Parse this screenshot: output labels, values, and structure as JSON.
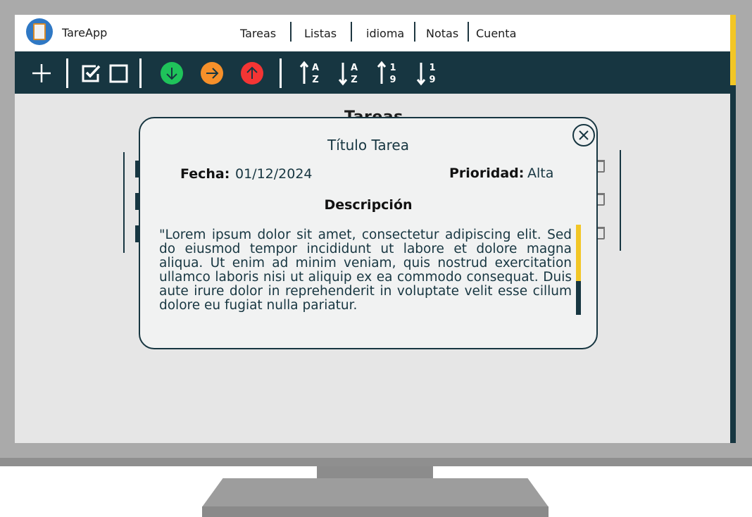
{
  "app": {
    "name": "TareApp",
    "logo_icon": "clipboard-icon"
  },
  "nav": {
    "items": [
      "Tareas",
      "Listas",
      "idioma",
      "Notas",
      "Cuenta"
    ]
  },
  "toolbar": {
    "icons": [
      "plus-icon",
      "check-all-icon",
      "uncheck-all-icon",
      "priority-low-icon",
      "priority-medium-icon",
      "priority-high-icon",
      "sort-alpha-asc-icon",
      "sort-alpha-desc-icon",
      "sort-numeric-asc-icon",
      "sort-numeric-desc-icon"
    ],
    "sort_letters": {
      "a": "A",
      "z": "Z",
      "one": "1",
      "nine": "9"
    }
  },
  "background": {
    "list_title": "Tareas"
  },
  "modal": {
    "title": "Título Tarea",
    "date_label": "Fecha:",
    "date_value": "01/12/2024",
    "priority_label": "Prioridad:",
    "priority_value": "Alta",
    "description_label": "Descripción",
    "description_text": "\"Lorem ipsum dolor sit amet, consectetur adipiscing elit. Sed do eiusmod tempor incididunt ut labore et dolore magna aliqua. Ut enim ad minim veniam, quis nostrud exercitation ullamco laboris nisi ut aliquip ex ea commodo consequat. Duis aute irure dolor in reprehenderit in voluptate velit esse cillum dolore eu fugiat nulla pariatur."
  },
  "colors": {
    "primary": "#173641",
    "accent": "#f2c626",
    "priority_low": "#1fc35a",
    "priority_medium": "#f6902a",
    "priority_high": "#f43534"
  }
}
